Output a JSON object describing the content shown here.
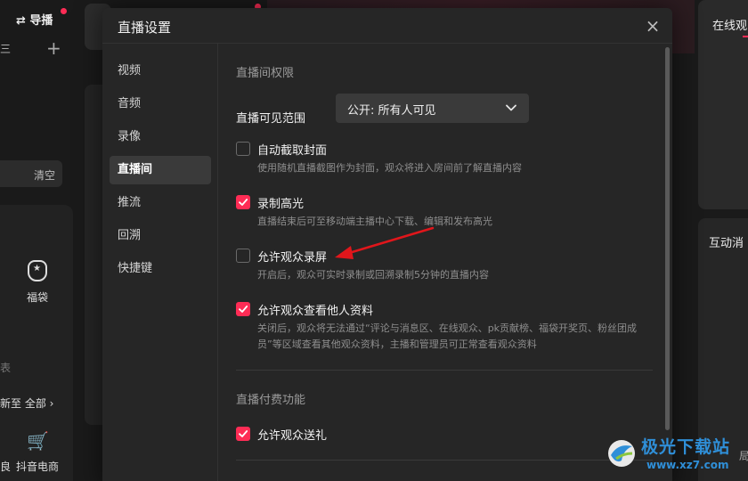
{
  "background": {
    "nav_label": "导播",
    "left_fragment": "三",
    "clear_label": "清空",
    "fudai_label": "福袋",
    "left_fragment2": "表",
    "update_text": "新至 全部",
    "shop_label": "抖音电商",
    "bottom_fragment": "良",
    "right_title": "在线观",
    "right_title2": "互动消",
    "right_bottom_fragment": "局"
  },
  "dialog": {
    "title": "直播设置",
    "close_icon": "×",
    "sidebar": [
      {
        "label": "视频"
      },
      {
        "label": "音频"
      },
      {
        "label": "录像"
      },
      {
        "label": "直播间"
      },
      {
        "label": "推流"
      },
      {
        "label": "回溯"
      },
      {
        "label": "快捷键"
      }
    ],
    "section1_title": "直播间权限",
    "visibility_label": "直播可见范围",
    "visibility_value": "公开: 所有人可见",
    "options": [
      {
        "label": "自动截取封面",
        "desc": "使用随机直播截图作为封面，观众将进入房间前了解直播内容",
        "checked": false
      },
      {
        "label": "录制高光",
        "desc": "直播结束后可至移动端主播中心下载、编辑和发布高光",
        "checked": true
      },
      {
        "label": "允许观众录屏",
        "desc": "开启后，观众可实时录制或回溯录制5分钟的直播内容",
        "checked": false
      },
      {
        "label": "允许观众查看他人资料",
        "desc": "关闭后，观众将无法通过“评论与消息区、在线观众、pk贡献榜、福袋开奖页、粉丝团成员”等区域查看其他观众资料，主播和管理员可正常查看观众资料",
        "checked": true
      }
    ],
    "section2_title": "直播付费功能",
    "gift_option": {
      "label": "允许观众送礼",
      "checked": true
    }
  },
  "watermark": {
    "name": "极光下载站",
    "url": "www.xz7.com"
  },
  "colors": {
    "accent": "#fe2c55",
    "arrow": "#e0161b"
  }
}
